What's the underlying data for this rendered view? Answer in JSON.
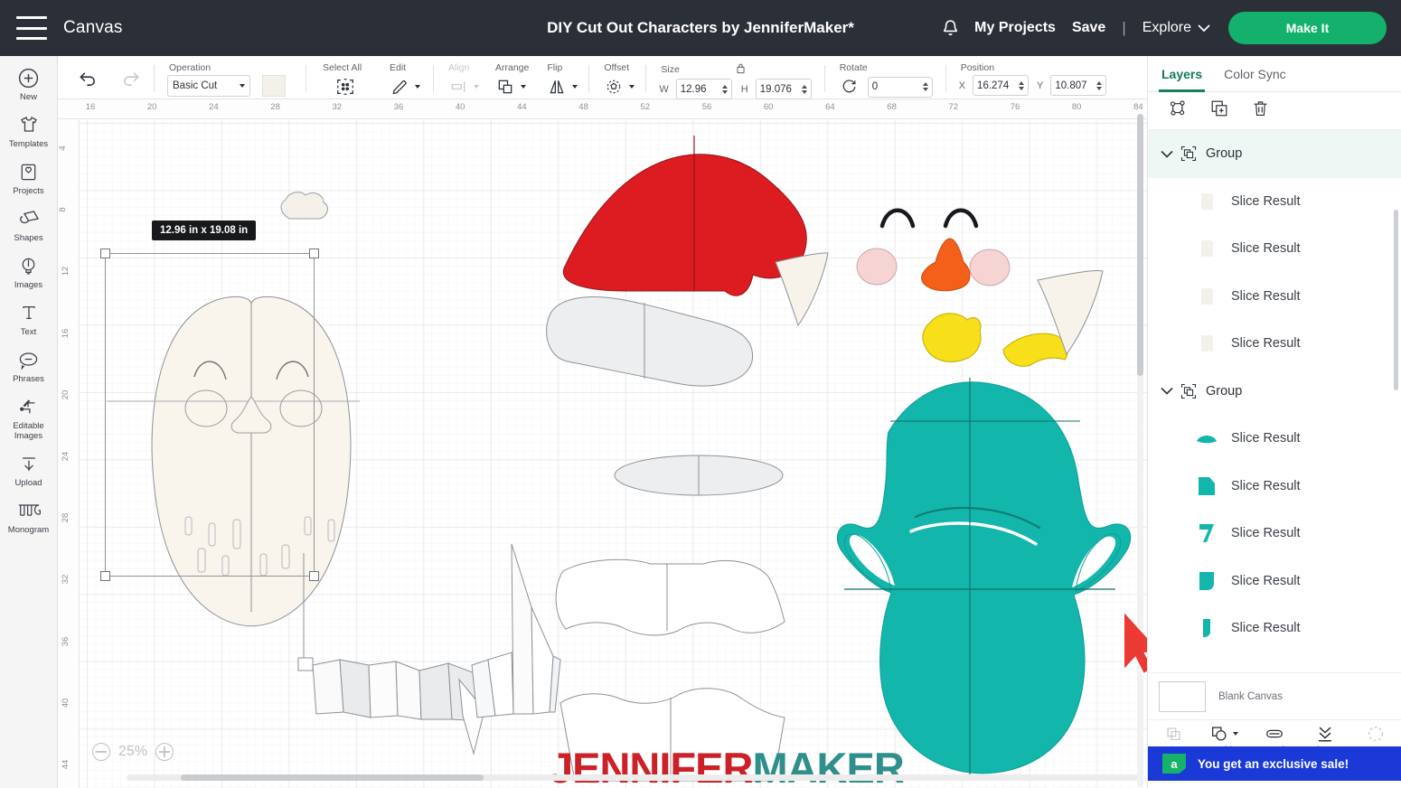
{
  "header": {
    "menu_icon": "hamburger-icon",
    "canvas_label": "Canvas",
    "project_title": "DIY Cut Out Characters by JenniferMaker*",
    "bell_icon": "notification-bell-icon",
    "my_projects": "My Projects",
    "save": "Save",
    "separator": "|",
    "explore": "Explore",
    "make_it": "Make It",
    "bg_color": "#2b3038",
    "accent_green": "#13b16b"
  },
  "toolbar": {
    "undo_icon": "undo-icon",
    "redo_icon": "redo-icon",
    "operation": {
      "label": "Operation",
      "value": "Basic Cut",
      "swatch_color": "#f4f1ea"
    },
    "select_all": {
      "label": "Select All",
      "icon": "select-all-icon"
    },
    "edit": {
      "label": "Edit",
      "icon": "pencil-icon"
    },
    "align": {
      "label": "Align",
      "icon": "align-icon",
      "disabled": true
    },
    "arrange": {
      "label": "Arrange",
      "icon": "arrange-icon"
    },
    "flip": {
      "label": "Flip",
      "icon": "flip-icon"
    },
    "offset": {
      "label": "Offset",
      "icon": "offset-icon"
    },
    "size": {
      "label": "Size",
      "w_label": "W",
      "w_value": "12.96",
      "h_label": "H",
      "h_value": "19.076",
      "lock_icon": "lock-icon"
    },
    "rotate": {
      "label": "Rotate",
      "icon": "rotate-icon",
      "value": "0"
    },
    "position": {
      "label": "Position",
      "x_label": "X",
      "x_value": "16.274",
      "y_label": "Y",
      "y_value": "10.807"
    }
  },
  "rail": {
    "items": [
      {
        "label": "New",
        "icon": "plus-circle-icon"
      },
      {
        "label": "Templates",
        "icon": "tshirt-icon"
      },
      {
        "label": "Projects",
        "icon": "projects-icon"
      },
      {
        "label": "Shapes",
        "icon": "shapes-icon"
      },
      {
        "label": "Images",
        "icon": "images-icon"
      },
      {
        "label": "Text",
        "icon": "text-icon"
      },
      {
        "label": "Phrases",
        "icon": "phrases-icon"
      },
      {
        "label": "Editable Images",
        "icon": "editable-images-icon"
      },
      {
        "label": "Upload",
        "icon": "upload-icon"
      },
      {
        "label": "Monogram",
        "icon": "monogram-icon"
      }
    ]
  },
  "canvas": {
    "ruler_h_ticks": [
      "16",
      "20",
      "24",
      "28",
      "32",
      "36",
      "40",
      "44",
      "48",
      "52",
      "56",
      "60",
      "64",
      "68",
      "72",
      "76",
      "80",
      "84"
    ],
    "ruler_v_ticks": [
      "4",
      "8",
      "12",
      "16",
      "20",
      "24",
      "28",
      "32",
      "36",
      "40",
      "44"
    ],
    "dimension_tooltip": "12.96  in x 19.08  in",
    "zoom_level": "25%",
    "zoom_out_icon": "minus-circle-icon",
    "zoom_in_icon": "plus-circle-icon",
    "watermark_part1": "JENNIFER",
    "watermark_part2": "MAKER",
    "watermark_color1": "#cc2128",
    "watermark_color2": "#2f8f8b",
    "shape_colors": {
      "santa_hat_red": "#dd1c21",
      "cream": "#f7f2e9",
      "teal": "#13b6ab",
      "yellow": "#f7e019",
      "orange": "#f4601a",
      "cheek_pink": "#f6d4d3",
      "grey_fill": "#eceef0",
      "outline": "#6f7479",
      "cursor_red": "#ea3a33"
    }
  },
  "right_panel": {
    "tabs": [
      {
        "label": "Layers",
        "active": true
      },
      {
        "label": "Color Sync",
        "active": false
      }
    ],
    "tools": [
      {
        "icon": "group-nodes-icon",
        "name": "group-tool"
      },
      {
        "icon": "duplicate-icon",
        "name": "duplicate-tool"
      },
      {
        "icon": "trash-icon",
        "name": "delete-tool"
      }
    ],
    "layers": [
      {
        "type": "group",
        "label": "Group",
        "selected": true,
        "chevron": "chevron-down-icon"
      },
      {
        "type": "slice",
        "label": "Slice Result",
        "thumb": "cream"
      },
      {
        "type": "slice",
        "label": "Slice Result",
        "thumb": "cream"
      },
      {
        "type": "slice",
        "label": "Slice Result",
        "thumb": "cream"
      },
      {
        "type": "slice",
        "label": "Slice Result",
        "thumb": "cream"
      },
      {
        "type": "group",
        "label": "Group",
        "selected": false,
        "chevron": "chevron-down-icon"
      },
      {
        "type": "slice",
        "label": "Slice Result",
        "thumb": "teal-arc"
      },
      {
        "type": "slice",
        "label": "Slice Result",
        "thumb": "teal-block"
      },
      {
        "type": "slice",
        "label": "Slice Result",
        "thumb": "teal-seven"
      },
      {
        "type": "slice",
        "label": "Slice Result",
        "thumb": "teal-tab"
      },
      {
        "type": "slice",
        "label": "Slice Result",
        "thumb": "teal-sliver"
      }
    ],
    "blank_canvas": {
      "label": "Blank Canvas"
    },
    "bottom_tools": [
      {
        "label": "Slice",
        "icon": "slice-icon",
        "disabled": true
      },
      {
        "label": "Combine",
        "icon": "combine-icon",
        "disabled": false,
        "has_caret": true
      },
      {
        "label": "Attach",
        "icon": "attach-icon",
        "disabled": false
      },
      {
        "label": "Flatten",
        "icon": "flatten-icon",
        "disabled": false
      },
      {
        "label": "Contour",
        "icon": "contour-icon",
        "disabled": true
      }
    ],
    "promo": {
      "text": "You get an exclusive sale!",
      "badge": "a",
      "bg_color": "#1a39d6",
      "badge_color": "#17b26a"
    }
  }
}
